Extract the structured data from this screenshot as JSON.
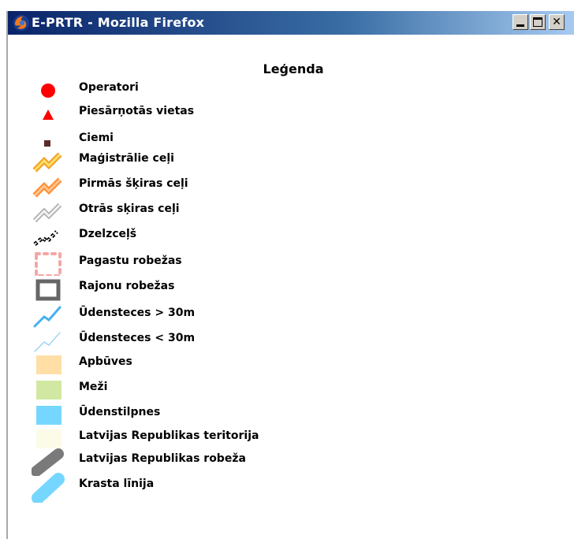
{
  "window": {
    "title": "E-PRTR - Mozilla Firefox",
    "app_icon": "firefox-icon",
    "buttons": [
      "minimize",
      "maximize",
      "close"
    ]
  },
  "legend": {
    "title": "Leģenda",
    "items": [
      {
        "label": "Operatori",
        "icon": "red-circle",
        "color": "#ff0000"
      },
      {
        "label": "Piesārņotās vietas",
        "icon": "red-triangle",
        "color": "#ff0000"
      },
      {
        "label": "Ciemi",
        "icon": "brown-square",
        "color": "#5a2a2a"
      },
      {
        "label": "Maģistrālie ceļi",
        "icon": "yellow-road",
        "color": "#ffd24a"
      },
      {
        "label": "Pirmās šķiras ceļi",
        "icon": "orange-road",
        "color": "#ffa64d"
      },
      {
        "label": "Otrās sķiras ceļi",
        "icon": "gray-road",
        "color": "#cccccc"
      },
      {
        "label": "Dzelzceļš",
        "icon": "railway",
        "color": "#000000"
      },
      {
        "label": "Pagastu robežas",
        "icon": "pink-dotted-border",
        "color": "#f4a6a6"
      },
      {
        "label": "Rajonu robežas",
        "icon": "gray-border",
        "color": "#666666"
      },
      {
        "label": "Ūdensteces > 30m",
        "icon": "blue-river-thick",
        "color": "#45b0f0"
      },
      {
        "label": "Ūdensteces < 30m",
        "icon": "blue-river-thin",
        "color": "#8fd0f5"
      },
      {
        "label": "Apbūves",
        "icon": "orange-fill",
        "color": "#ffdfa6"
      },
      {
        "label": "Meži",
        "icon": "green-fill",
        "color": "#d1e8a3"
      },
      {
        "label": "Ūdenstilpnes",
        "icon": "cyan-fill",
        "color": "#75d7ff"
      },
      {
        "label": "Latvijas Republikas teritorija",
        "icon": "cream-fill",
        "color": "#fbfbe8"
      },
      {
        "label": "Latvijas Republikas robeža",
        "icon": "gray-stroke",
        "color": "#7a7a7a"
      },
      {
        "label": "Krasta līnija",
        "icon": "blue-stroke",
        "color": "#75d7ff"
      }
    ]
  }
}
